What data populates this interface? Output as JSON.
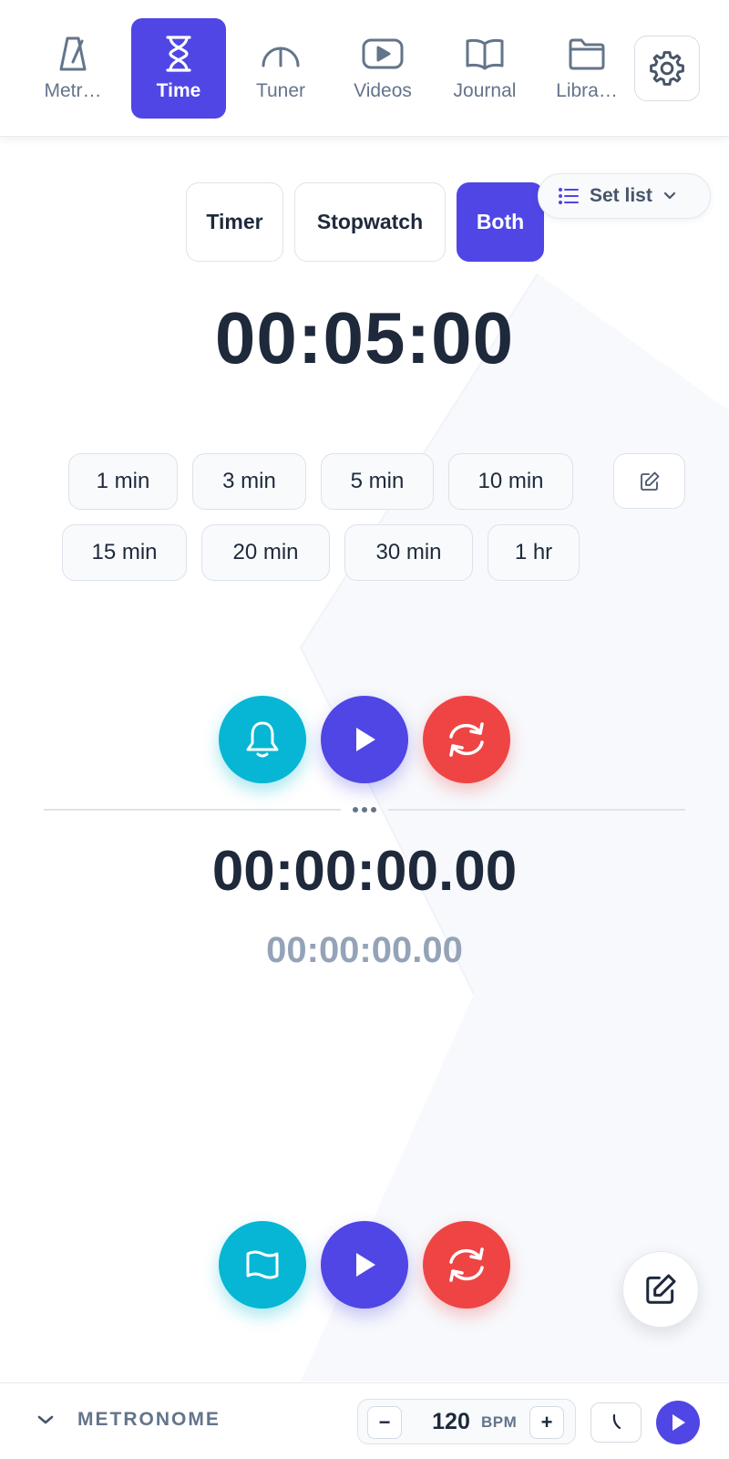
{
  "nav": {
    "items": [
      {
        "label": "Metr…",
        "icon": "metronome-icon"
      },
      {
        "label": "Time",
        "icon": "hourglass-icon",
        "active": true
      },
      {
        "label": "Tuner",
        "icon": "gauge-icon"
      },
      {
        "label": "Videos",
        "icon": "video-play-icon"
      },
      {
        "label": "Journal",
        "icon": "open-book-icon"
      },
      {
        "label": "Libra…",
        "icon": "folder-icon"
      }
    ],
    "settings_icon": "gear-icon"
  },
  "modes": {
    "timer": "Timer",
    "stopwatch": "Stopwatch",
    "both": "Both",
    "active": "Both"
  },
  "setlist": {
    "label": "Set list"
  },
  "timer": {
    "display": "00:05:00",
    "presets": [
      "1 min",
      "3 min",
      "5 min",
      "10 min",
      "15 min",
      "20 min",
      "30 min",
      "1 hr"
    ]
  },
  "stopwatch": {
    "display": "00:00:00.00",
    "lap": "00:00:00.00"
  },
  "metronome_bar": {
    "label": "METRONOME",
    "bpm": "120",
    "bpm_unit": "BPM",
    "decrement": "−",
    "increment": "+"
  },
  "colors": {
    "accent": "#4f46e5",
    "cyan": "#06b6d4",
    "red": "#ef4444",
    "text": "#1e293b",
    "muted": "#64748b"
  }
}
